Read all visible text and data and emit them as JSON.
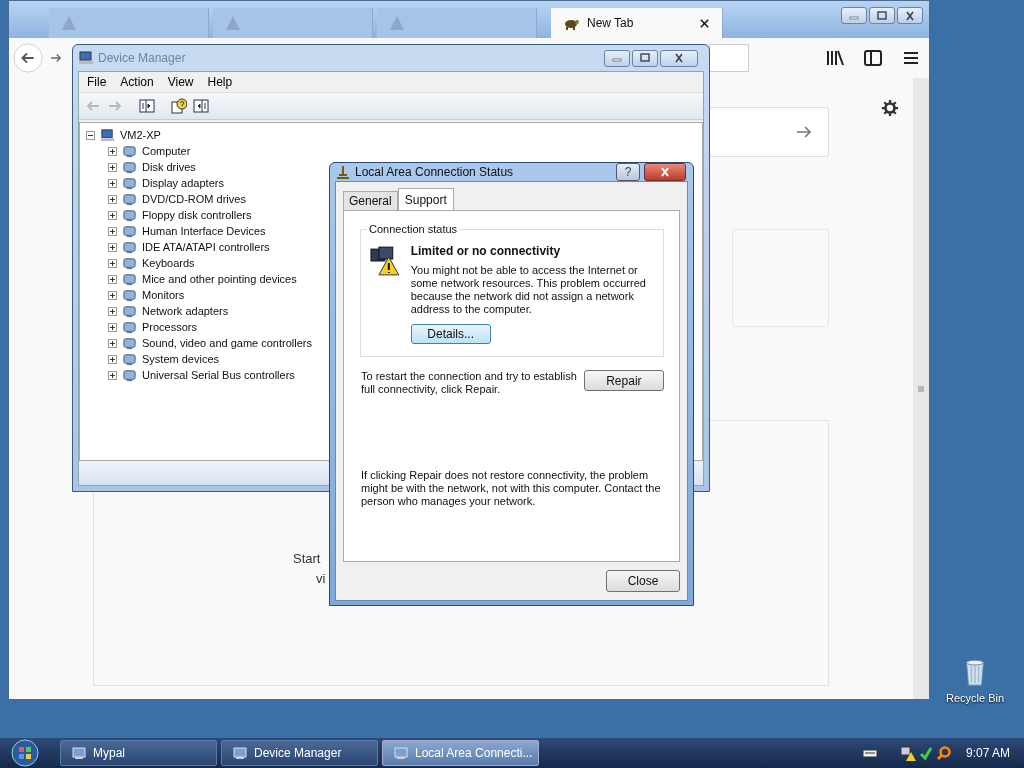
{
  "browser": {
    "tabs": [
      {
        "kind": "faded",
        "selected": false
      },
      {
        "kind": "faded",
        "selected": false
      },
      {
        "kind": "faded",
        "selected": false
      },
      {
        "kind": "titled",
        "label": "New Tab",
        "selected": true
      }
    ],
    "content": {
      "partial_texts": [
        "Start",
        "vi"
      ]
    }
  },
  "device_manager": {
    "title": "Device Manager",
    "menu": [
      "File",
      "Action",
      "View",
      "Help"
    ],
    "tree": {
      "label": "VM2-XP",
      "expanded": true,
      "children": [
        {
          "label": "Computer",
          "expanded": false
        },
        {
          "label": "Disk drives",
          "expanded": false
        },
        {
          "label": "Display adapters",
          "expanded": false
        },
        {
          "label": "DVD/CD-ROM drives",
          "expanded": false
        },
        {
          "label": "Floppy disk controllers",
          "expanded": false
        },
        {
          "label": "Human Interface Devices",
          "expanded": false
        },
        {
          "label": "IDE ATA/ATAPI controllers",
          "expanded": false
        },
        {
          "label": "Keyboards",
          "expanded": false
        },
        {
          "label": "Mice and other pointing devices",
          "expanded": false
        },
        {
          "label": "Monitors",
          "expanded": false
        },
        {
          "label": "Network adapters",
          "expanded": false
        },
        {
          "label": "Processors",
          "expanded": false
        },
        {
          "label": "Sound, video and game controllers",
          "expanded": false
        },
        {
          "label": "System devices",
          "expanded": false
        },
        {
          "label": "Universal Serial Bus controllers",
          "expanded": false
        }
      ]
    }
  },
  "dialog": {
    "title": "Local Area Connection Status",
    "help_button": "?",
    "tabs": [
      {
        "label": "General",
        "selected": false
      },
      {
        "label": "Support",
        "selected": true
      }
    ],
    "group_label": "Connection status",
    "status_title": "Limited or no connectivity",
    "status_text": "You might not be able to access the Internet or some network resources. This problem occurred because the network did not assign a network address to the computer.",
    "details_button": "Details...",
    "repair_text": "To restart the connection and try to establish full connectivity, click Repair.",
    "repair_button": "Repair",
    "footer_text": "If clicking Repair does not restore connectivity, the problem might be with the network, not with this computer. Contact the person who manages your network.",
    "close_button": "Close"
  },
  "desktop": {
    "icons": [
      {
        "label": "Recycle Bin"
      }
    ]
  },
  "taskbar": {
    "items": [
      {
        "label": "Mypal",
        "selected": false
      },
      {
        "label": "Device Manager",
        "selected": false
      },
      {
        "label": "Local Area Connecti...",
        "selected": true
      }
    ],
    "clock": "9:07 AM"
  }
}
